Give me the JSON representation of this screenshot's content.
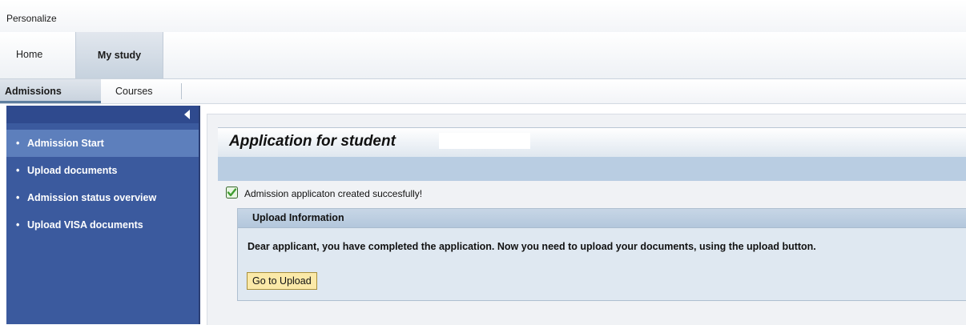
{
  "header": {
    "personalize_label": "Personalize"
  },
  "top_tabs": [
    {
      "label": "Home",
      "selected": false
    },
    {
      "label": "My study",
      "selected": true
    }
  ],
  "sub_tabs": [
    {
      "label": "Admissions",
      "selected": true
    },
    {
      "label": "Courses",
      "selected": false
    }
  ],
  "sidebar": {
    "collapse_icon": "triangle-left-icon",
    "items": [
      {
        "label": "Admission Start",
        "selected": true
      },
      {
        "label": "Upload documents",
        "selected": false
      },
      {
        "label": "Admission status overview",
        "selected": false
      },
      {
        "label": "Upload VISA documents",
        "selected": false
      }
    ]
  },
  "main": {
    "title": "Application for student",
    "success_icon": "checkbox-checked-icon",
    "success_message": "Admission applicaton created succesfully!",
    "upload_panel": {
      "title": "Upload Information",
      "description": "Dear applicant, you have completed the application. Now you need to upload your documents, using the upload button.",
      "button_label": "Go to Upload"
    }
  },
  "colors": {
    "sidebar_bg": "#3b5a9e",
    "sidebar_selected": "#5d7fbc",
    "panel_bg": "#dfe8f1",
    "button_bg": "#fbe9a8",
    "success_green": "#3f9d2f"
  }
}
